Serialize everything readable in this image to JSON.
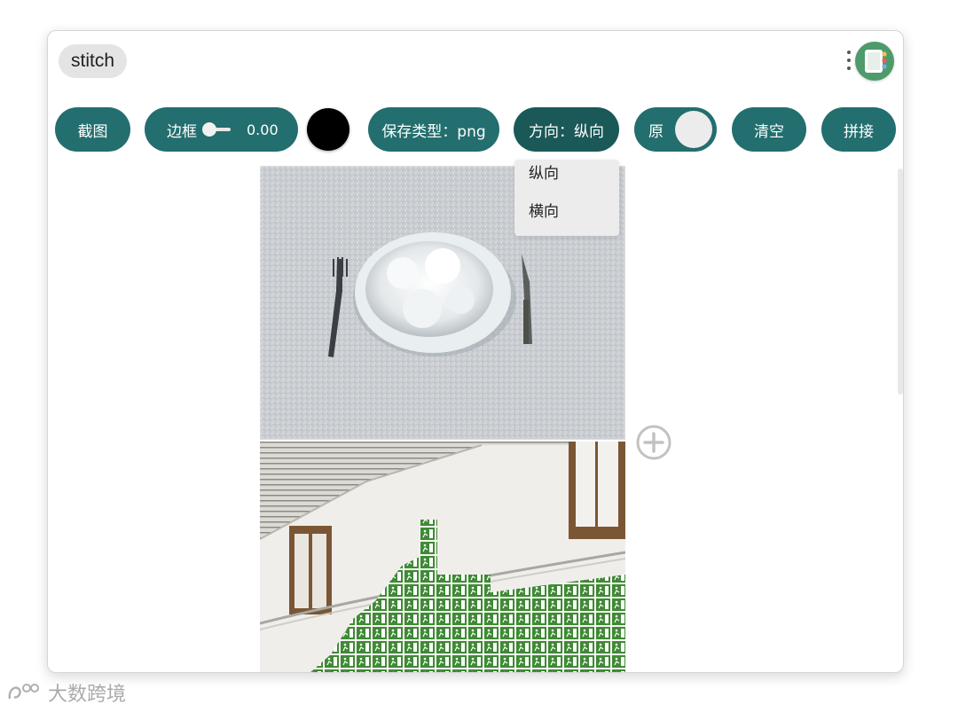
{
  "header": {
    "app_title": "stitch",
    "menu_icon": "kebab-vertical-icon",
    "extension_icon": "extension-app-icon"
  },
  "toolbar": {
    "screenshot_label": "截图",
    "border_label": "边框",
    "border_value": "0.00",
    "border_slider_value": 0,
    "border_color": "#000000",
    "save_type_label": "保存类型：png",
    "direction_label": "方向：纵向",
    "original_label": "原",
    "original_toggle_on": true,
    "clear_label": "清空",
    "stitch_label": "拼接"
  },
  "direction_dropdown": {
    "options": [
      "纵向",
      "横向"
    ]
  },
  "canvas": {
    "images": [
      "snow-plate-photo",
      "exit-signs-wall-photo"
    ],
    "add_icon": "plus-circle-icon"
  },
  "watermark": {
    "text": "大数跨境"
  },
  "colors": {
    "accent": "#236e6e",
    "accent_active": "#1b5858",
    "dropdown_bg": "#ececec"
  }
}
